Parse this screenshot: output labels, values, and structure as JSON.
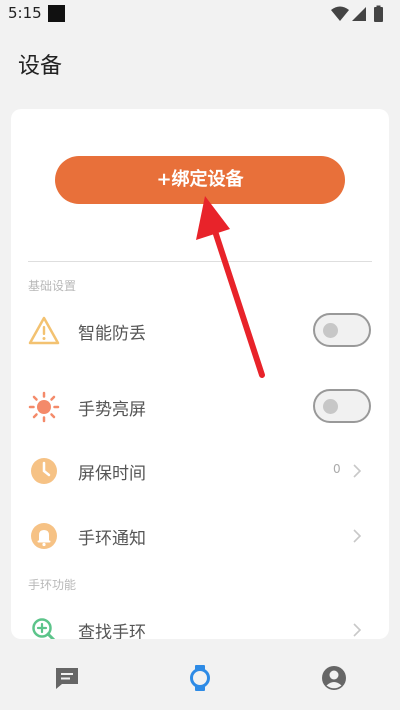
{
  "status_bar": {
    "time": "5:15",
    "icons": [
      "notification-square-icon",
      "wifi-icon",
      "cell-signal-icon",
      "battery-icon"
    ]
  },
  "header": {
    "title": "设备"
  },
  "bind_button": {
    "label": "+绑定设备",
    "color": "#e8703a"
  },
  "sections": {
    "basic": {
      "label": "基础设置",
      "items": [
        {
          "label": "智能防丢",
          "icon": "warning-triangle-icon",
          "control": "toggle",
          "on": false
        },
        {
          "label": "手势亮屏",
          "icon": "sun-icon",
          "control": "toggle",
          "on": false
        },
        {
          "label": "屏保时间",
          "icon": "clock-icon",
          "control": "chevron",
          "value": "0"
        },
        {
          "label": "手环通知",
          "icon": "bell-icon",
          "control": "chevron"
        }
      ]
    },
    "band": {
      "label": "手环功能",
      "items": [
        {
          "label": "查找手环",
          "icon": "magnifier-plus-icon",
          "control": "chevron"
        }
      ]
    }
  },
  "bottom_nav": {
    "items": [
      {
        "icon": "chat-bubble-icon",
        "active": false
      },
      {
        "icon": "watch-icon",
        "active": true
      },
      {
        "icon": "profile-icon",
        "active": false
      }
    ],
    "active_color": "#2e8be6",
    "inactive_color": "#666666"
  },
  "annotation_arrow": {
    "color": "#e8232a",
    "points_to": "+绑定设备"
  }
}
